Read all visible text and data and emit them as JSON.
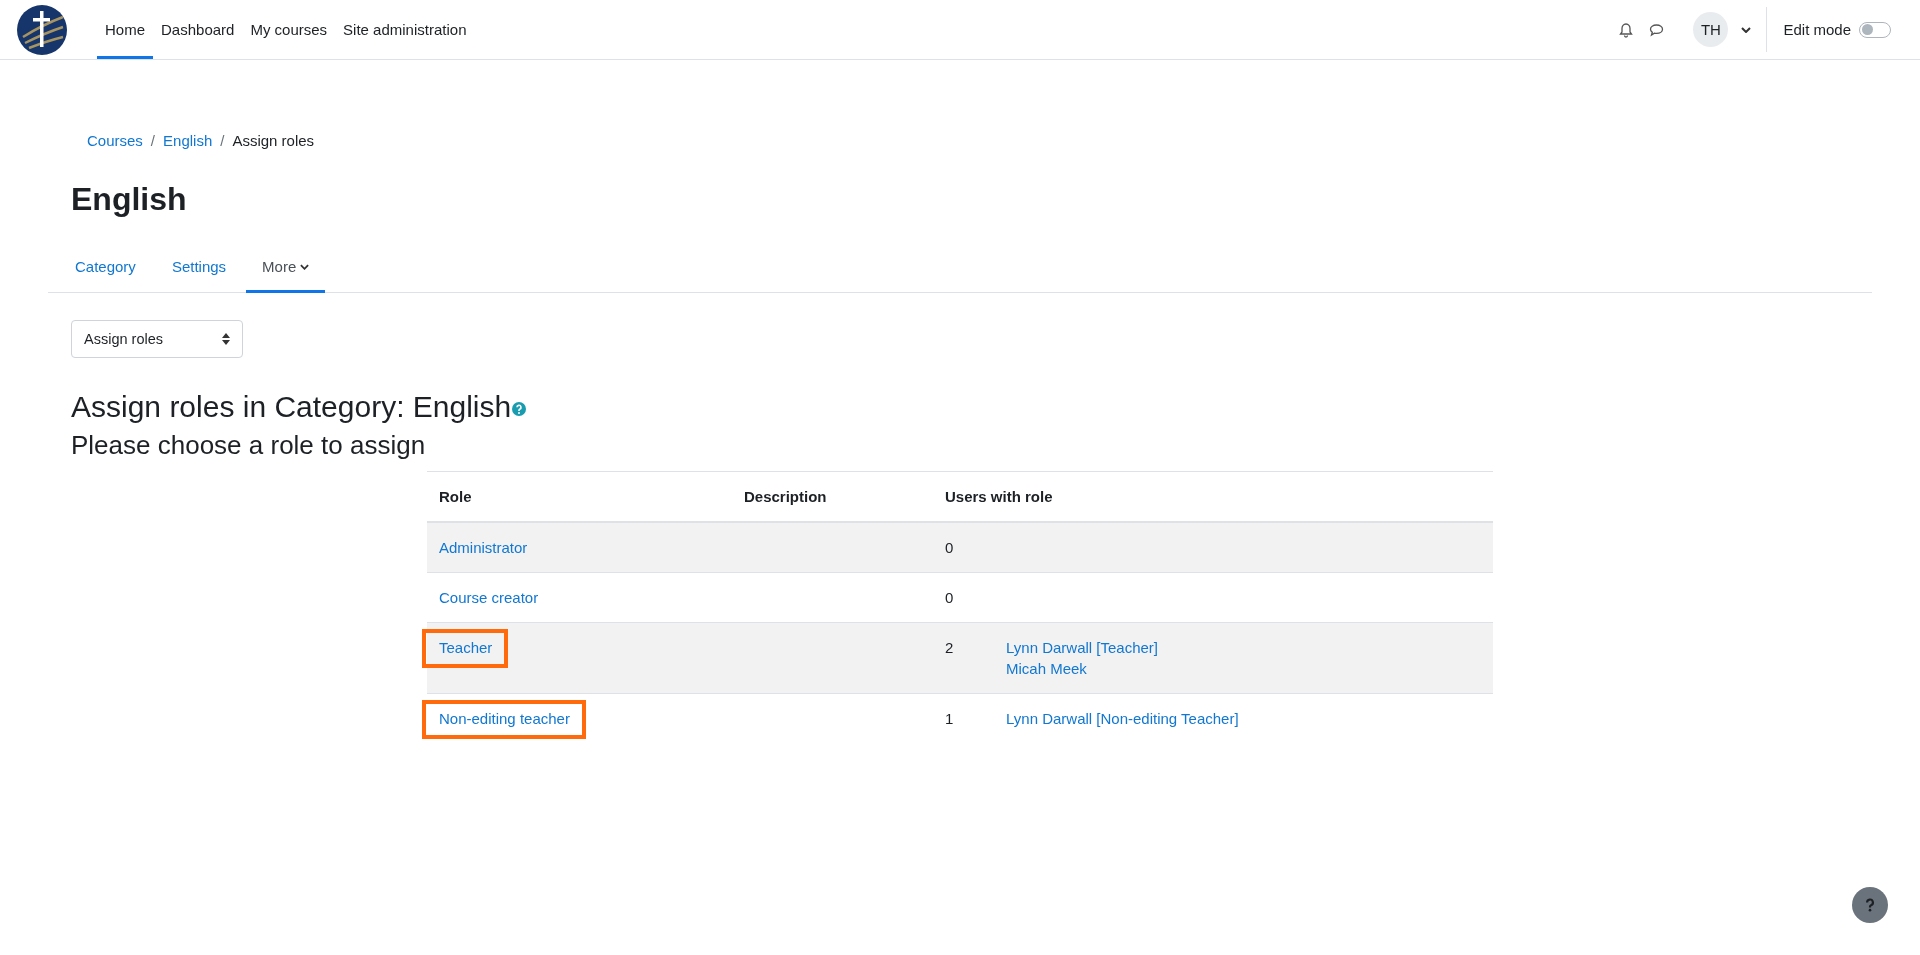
{
  "navbar": {
    "items": [
      {
        "label": "Home",
        "selected": true
      },
      {
        "label": "Dashboard",
        "selected": false
      },
      {
        "label": "My courses",
        "selected": false
      },
      {
        "label": "Site administration",
        "selected": false
      }
    ],
    "user_initials": "TH",
    "edit_mode": {
      "label": "Edit mode",
      "on": false
    }
  },
  "breadcrumb_separator": "/",
  "breadcrumb": [
    {
      "label": "Courses",
      "link": true
    },
    {
      "label": "English",
      "link": true
    },
    {
      "label": "Assign roles",
      "link": false
    }
  ],
  "page_title": "English",
  "tabs": [
    {
      "label": "Category",
      "selected": false,
      "dropdown": false
    },
    {
      "label": "Settings",
      "selected": false,
      "dropdown": false
    },
    {
      "label": "More",
      "selected": true,
      "dropdown": true
    }
  ],
  "select": {
    "value": "Assign roles"
  },
  "heading": "Assign roles in Category: English",
  "subheading": "Please choose a role to assign",
  "table": {
    "columns": [
      "Role",
      "Description",
      "Users with role"
    ],
    "rows": [
      {
        "role": "Administrator",
        "count": "0",
        "users": [],
        "highlighted": false
      },
      {
        "role": "Course creator",
        "count": "0",
        "users": [],
        "highlighted": false
      },
      {
        "role": "Teacher",
        "count": "2",
        "users": [
          "Lynn Darwall [Teacher]",
          "Micah Meek"
        ],
        "highlighted": true
      },
      {
        "role": "Non-editing teacher",
        "count": "1",
        "users": [
          "Lynn Darwall [Non-editing Teacher]"
        ],
        "highlighted": true
      }
    ]
  }
}
